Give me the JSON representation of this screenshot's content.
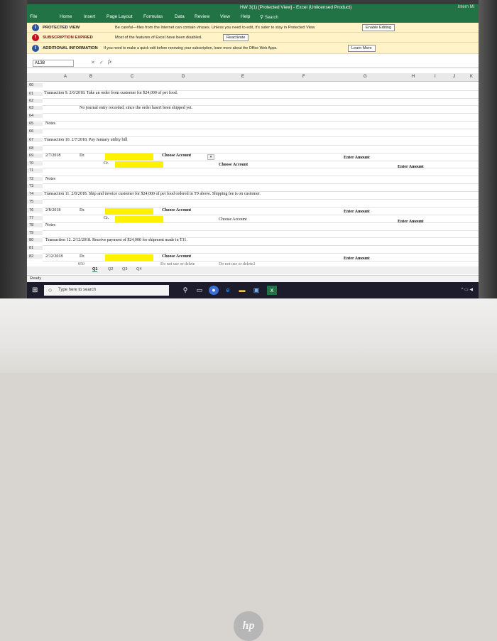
{
  "window": {
    "title": "HW 3(1) [Protected View] - Excel (Unlicensed Product)",
    "warning": "Intern Mi"
  },
  "ribbon": {
    "tabs": [
      "File",
      "Home",
      "Insert",
      "Page Layout",
      "Formulas",
      "Data",
      "Review",
      "View",
      "Help"
    ],
    "search_label": "Search"
  },
  "protected_view": {
    "title": "PROTECTED VIEW",
    "text": "Be careful—files from the Internet can contain viruses. Unless you need to edit, it's safer to stay in Protected View.",
    "button": "Enable Editing"
  },
  "subscription": {
    "title": "SUBSCRIPTION EXPIRED",
    "text": "Most of the features of Excel have been disabled.",
    "button": "Reactivate"
  },
  "additional_info": {
    "title": "ADDITIONAL INFORMATION",
    "text": "If you need to make a quick edit before renewing your subscription, learn more about the Office Web Apps.",
    "button": "Learn More"
  },
  "formula_bar": {
    "name_box": "A138",
    "cancel": "✕",
    "enter": "✓",
    "fx": "fx"
  },
  "columns": [
    "A",
    "B",
    "C",
    "D",
    "E",
    "F",
    "G",
    "H",
    "I",
    "J",
    "K"
  ],
  "rows": {
    "r60": "60",
    "r61": "61",
    "r62": "62",
    "r63": "63",
    "r64": "64",
    "r65": "65",
    "r66": "66",
    "r67": "67",
    "r68": "68",
    "r69": "69",
    "r70": "70",
    "r71": "71",
    "r72": "72",
    "r73": "73",
    "r74": "74",
    "r75": "75",
    "r76": "76",
    "r77": "77",
    "r78": "78",
    "r79": "79",
    "r80": "80",
    "r81": "81",
    "r82": "82"
  },
  "cells": {
    "t9": "Transaction 9. 2/6/2018. Take an order from customer for $24,000 of pet food.",
    "no_journal": "No journal entry recorded, since the order hasn't been shipped yet.",
    "notes65": "Notes",
    "t10": "Transaction 10. 2/7/2018. Pay January utility bill",
    "d69": "2/7/2018",
    "dr69": "Dr.",
    "acct69": "Choose Account",
    "amt69": "Enter Amount",
    "cr70": "Cr.",
    "acct70": "Choose Account",
    "amt70": "Enter Amount",
    "notes72": "Notes",
    "t11": "Transaction 11. 2/8/2018. Ship and invoice customer for $24,000 of pet food ordered in T9 above. Shipping fee is on customer.",
    "d76": "2/8/2018",
    "dr76": "Dr.",
    "acct76": "Choose Account",
    "amt76": "Enter Amount",
    "cr77": "Cr.",
    "acct77": "Choose Account",
    "amt77": "Enter Amount",
    "notes78": "Notes",
    "t12": "Transaction 12. 2/12/2018. Receive payment of $24,000 for shipment made in T11.",
    "d82": "2/12/2018",
    "dr82": "Dr.",
    "acct82": "Choose Account",
    "amt82": "Enter Amount",
    "r83_850": "850",
    "r83_warn1": "Do not use or delete",
    "r83_warn2": "Do not use or delete2"
  },
  "sheet_tabs": [
    "Q1",
    "Q2",
    "Q3",
    "Q4"
  ],
  "status": {
    "ready": "Ready"
  },
  "taskbar": {
    "search_placeholder": "Type here to search"
  },
  "colors": {
    "excel_green": "#217346",
    "highlight": "#fff200",
    "message_bar": "#fff3c7"
  }
}
